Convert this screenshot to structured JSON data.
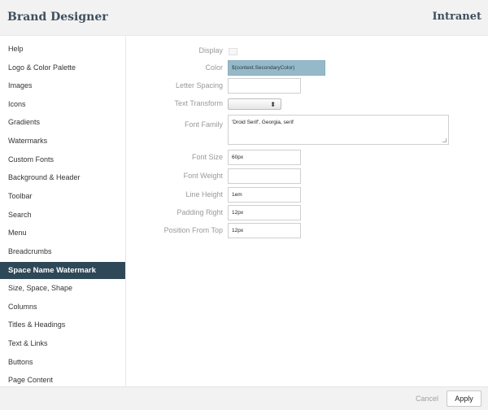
{
  "header": {
    "title": "Brand Designer",
    "brand": "Intranet"
  },
  "sidebar": {
    "items": [
      {
        "label": "Help"
      },
      {
        "label": "Logo & Color Palette"
      },
      {
        "label": "Images"
      },
      {
        "label": "Icons"
      },
      {
        "label": "Gradients"
      },
      {
        "label": "Watermarks"
      },
      {
        "label": "Custom Fonts"
      },
      {
        "label": "Background & Header"
      },
      {
        "label": "Toolbar"
      },
      {
        "label": "Search"
      },
      {
        "label": "Menu"
      },
      {
        "label": "Breadcrumbs"
      },
      {
        "label": "Space Name Watermark",
        "active": true
      },
      {
        "label": "Size, Space, Shape"
      },
      {
        "label": "Columns"
      },
      {
        "label": "Titles & Headings"
      },
      {
        "label": "Text & Links"
      },
      {
        "label": "Buttons"
      },
      {
        "label": "Page Content"
      }
    ]
  },
  "form": {
    "display_label": "Display",
    "color_label": "Color",
    "color_value": "$(context.SecondaryColor)",
    "letter_spacing_label": "Letter Spacing",
    "letter_spacing_value": "",
    "text_transform_label": "Text Transform",
    "text_transform_value": "",
    "font_family_label": "Font Family",
    "font_family_value": "'Droid Serif', Georgia, serif",
    "font_size_label": "Font Size",
    "font_size_value": "60px",
    "font_weight_label": "Font Weight",
    "font_weight_value": "",
    "line_height_label": "Line Height",
    "line_height_value": "1em",
    "padding_right_label": "Padding Right",
    "padding_right_value": "12px",
    "position_top_label": "Position From Top",
    "position_top_value": "12px"
  },
  "footer": {
    "cancel_label": "Cancel",
    "apply_label": "Apply"
  },
  "colors": {
    "header_bg": "#f2f2f2",
    "active_bg": "#2f4858",
    "color_field_bg": "#96b9c9"
  }
}
